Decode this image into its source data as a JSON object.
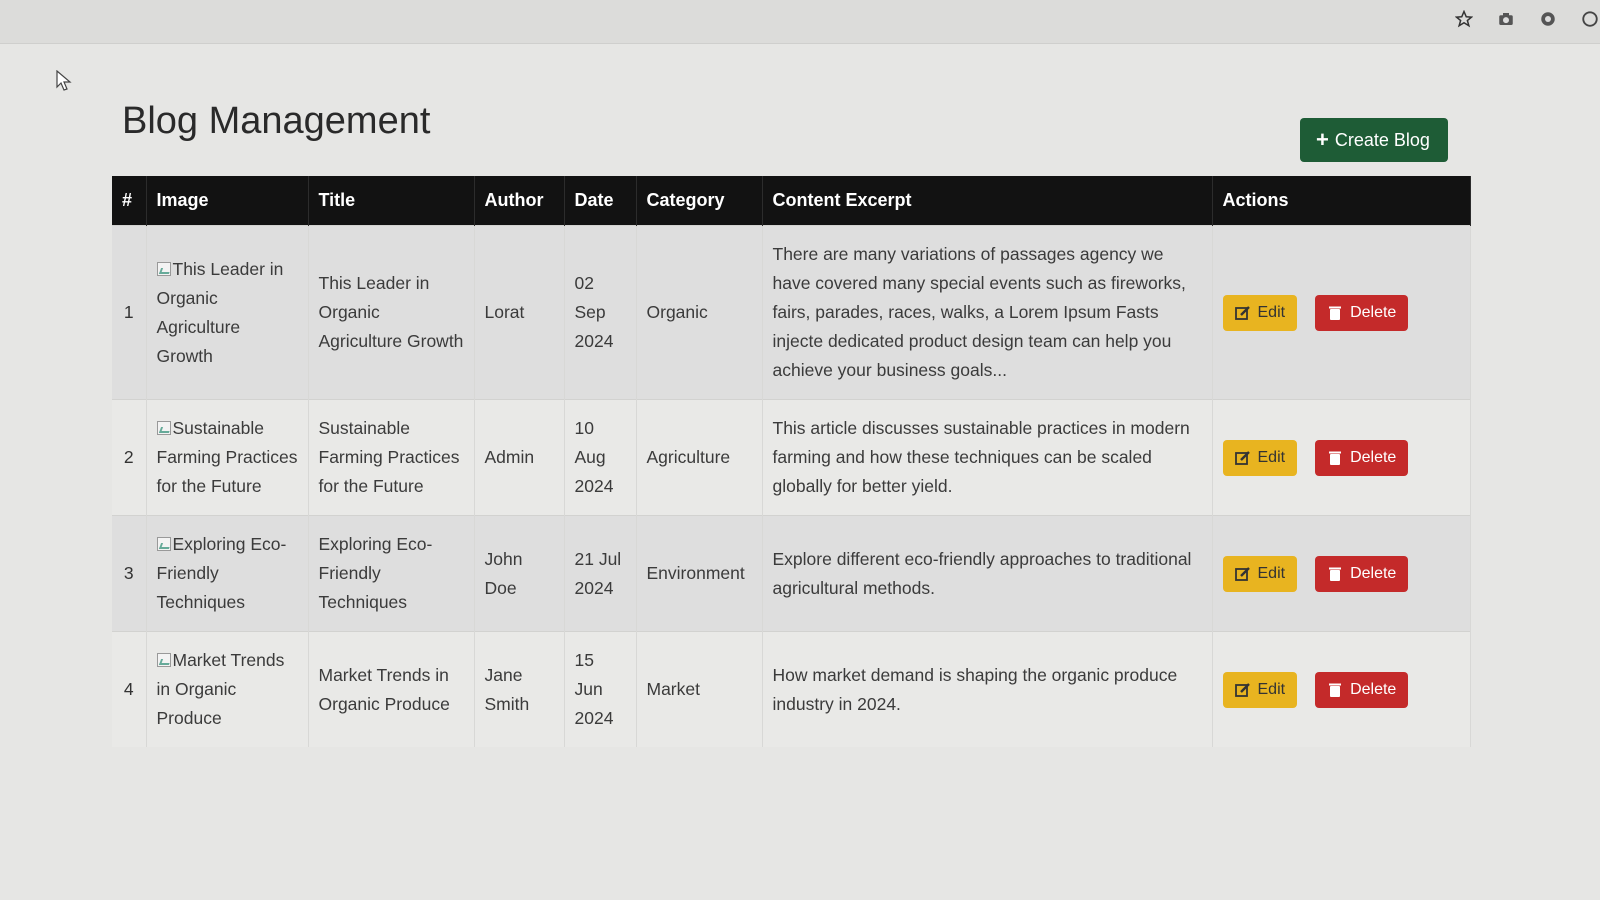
{
  "header": {
    "title": "Blog Management",
    "create_button": "Create Blog"
  },
  "table": {
    "columns": [
      "#",
      "Image",
      "Title",
      "Author",
      "Date",
      "Category",
      "Content Excerpt",
      "Actions"
    ],
    "rows": [
      {
        "num": "1",
        "image_alt": "This Leader in Organic Agriculture Growth",
        "title": "This Leader in Organic Agriculture Growth",
        "author": "Lorat",
        "date": "02 Sep 2024",
        "category": "Organic",
        "excerpt": "There are many variations of passages agency we have covered many special events such as fireworks, fairs, parades, races, walks, a Lorem Ipsum Fasts injecte dedicated product design team can help you achieve your business goals...",
        "edit": "Edit",
        "delete": "Delete"
      },
      {
        "num": "2",
        "image_alt": "Sustainable Farming Practices for the Future",
        "title": "Sustainable Farming Practices for the Future",
        "author": "Admin",
        "date": "10 Aug 2024",
        "category": "Agriculture",
        "excerpt": "This article discusses sustainable practices in modern farming and how these techniques can be scaled globally for better yield.",
        "edit": "Edit",
        "delete": "Delete"
      },
      {
        "num": "3",
        "image_alt": "Exploring Eco-Friendly Techniques",
        "title": "Exploring Eco-Friendly Techniques",
        "author": "John Doe",
        "date": "21 Jul 2024",
        "category": "Environment",
        "excerpt": "Explore different eco-friendly approaches to traditional agricultural methods.",
        "edit": "Edit",
        "delete": "Delete"
      },
      {
        "num": "4",
        "image_alt": "Market Trends in Organic Produce",
        "title": "Market Trends in Organic Produce",
        "author": "Jane Smith",
        "date": "15 Jun 2024",
        "category": "Market",
        "excerpt": "How market demand is shaping the organic produce industry in 2024.",
        "edit": "Edit",
        "delete": "Delete"
      }
    ]
  },
  "icons": {
    "toolbar": [
      "star-icon",
      "camera-icon",
      "extension-icon",
      "profile-icon"
    ],
    "create": "plus-icon",
    "edit": "edit-icon",
    "delete": "trash-icon"
  },
  "colors": {
    "create_button": "#1e5c36",
    "edit_button": "#e8b420",
    "delete_button": "#c42a2a",
    "table_header": "#121212"
  }
}
